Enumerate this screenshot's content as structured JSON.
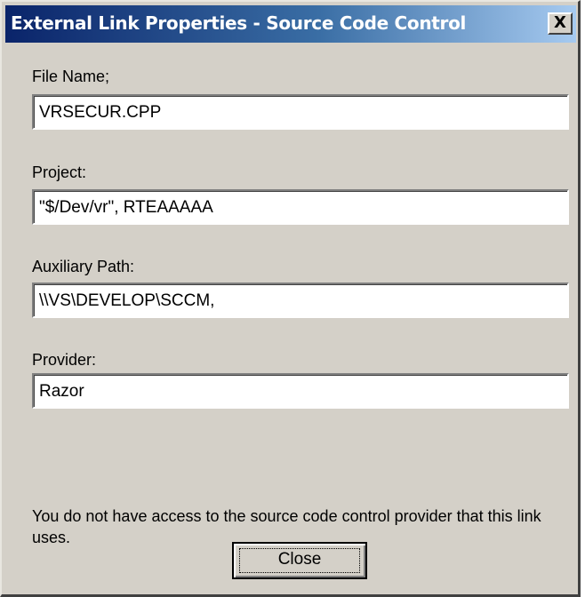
{
  "window": {
    "title": "External Link Properties - Source Code Control",
    "close_glyph": "X",
    "close_icon": "close-icon"
  },
  "fields": {
    "file_name": {
      "label": "File Name;",
      "value": "VRSECUR.CPP"
    },
    "project": {
      "label": "Project:",
      "value": "\"$/Dev/vr\", RTEAAAAA"
    },
    "auxiliary_path": {
      "label": "Auxiliary Path:",
      "value": "\\\\VS\\DEVELOP\\SCCM,"
    },
    "provider": {
      "label": "Provider:",
      "value": "Razor"
    }
  },
  "message": "You do not have access to the source code control provider that this link uses.",
  "buttons": {
    "close_label": "Close"
  },
  "colors": {
    "title_gradient_start": "#0a246a",
    "title_gradient_end": "#a6caf0",
    "dialog_face": "#d4d0c8"
  }
}
